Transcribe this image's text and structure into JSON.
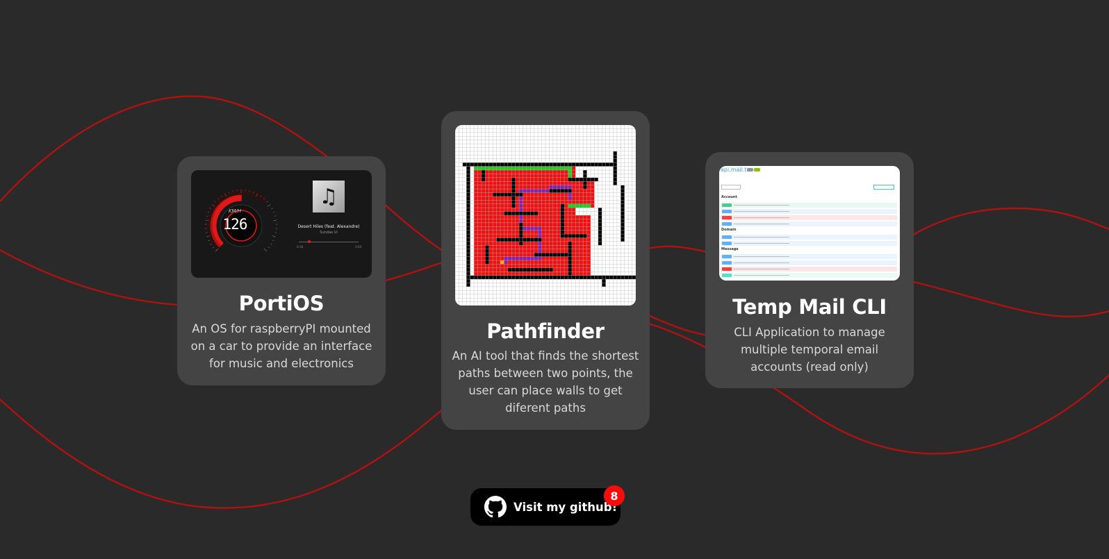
{
  "theme": {
    "background": "#2a2a2a",
    "card": "#444444",
    "accent": "#cc1111"
  },
  "projects": [
    {
      "title": "PortiOS",
      "description": "An OS for raspberryPI mounted on a car to provide an interface for music and electronics",
      "preview": {
        "speed": "126",
        "unit": "KM/H",
        "song": "Desert Hiles (feat. Alexandre)",
        "artist": "Sundae Ui",
        "time_start": "0:18",
        "time_end": "3:04",
        "progress": 0.2,
        "icon": "music-note-icon"
      }
    },
    {
      "title": "Pathfinder",
      "description": "An AI tool that finds the shortest paths between two points, the user can place walls to get diferent paths"
    },
    {
      "title": "Temp Mail CLI",
      "description": "CLI Application to manage multiple temporal email accounts (read only)",
      "preview": {
        "api_title": "api.mail.tm",
        "sections": [
          "Account",
          "Domain",
          "Message"
        ],
        "row_colors": [
          "#49cc90",
          "#61affe",
          "#f93e3e",
          "#61affe",
          "#61affe",
          "#61affe",
          "#61affe",
          "#61affe",
          "#f93e3e",
          "#50e3c2"
        ]
      }
    }
  ],
  "github": {
    "label": "Visit my github!",
    "count": "8",
    "icon": "github-icon"
  }
}
